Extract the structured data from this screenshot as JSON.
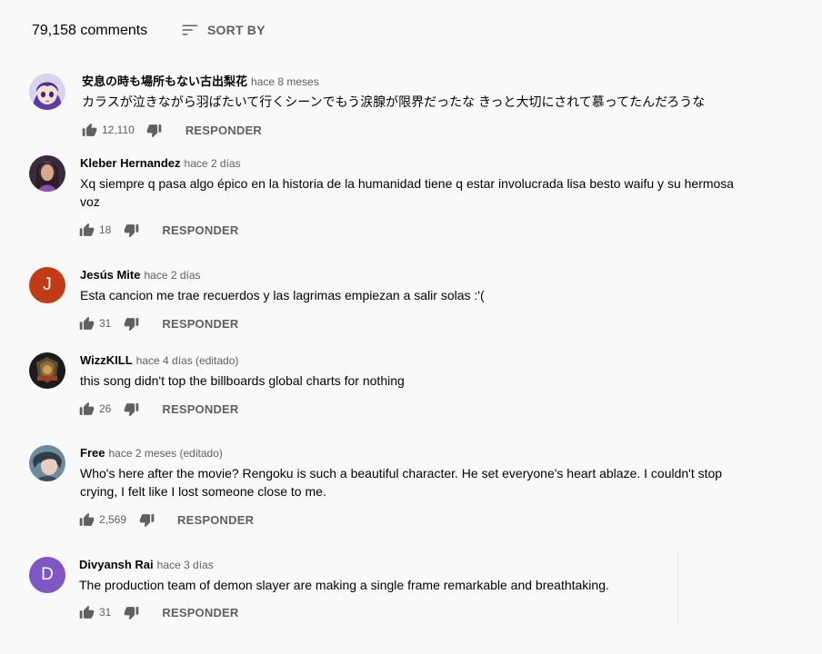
{
  "header": {
    "comment_count": "79,158 comments",
    "sort_label": "SORT BY"
  },
  "comments": [
    {
      "author": "安息の時も場所もない古出梨花",
      "time": "hace 8 meses",
      "lines": [
        "カラスが泣きながら羽ばたいて行くシーンでもう涙腺が限界だったな きっと大切にされて慕ってたんだろうな"
      ],
      "likes": "12,110",
      "reply": "RESPONDER"
    },
    {
      "author": "Kleber Hernandez",
      "time": "hace 2 días",
      "lines": [
        "Xq siempre q pasa algo épico en la historia de la humanidad tiene q estar involucrada lisa besto waifu y su hermosa",
        "voz"
      ],
      "likes": "18",
      "reply": "RESPONDER"
    },
    {
      "author": "Jesús Mite",
      "time": "hace 2 días",
      "avatar_letter": "J",
      "lines": [
        "Esta cancion me trae recuerdos y las lagrimas empiezan a salir solas :'("
      ],
      "likes": "31",
      "reply": "RESPONDER"
    },
    {
      "author": "WizzKILL",
      "time": "hace 4 días (editado)",
      "lines": [
        "this song didn't top the billboards global charts for nothing"
      ],
      "likes": "26",
      "reply": "RESPONDER"
    },
    {
      "author": "Free",
      "time": "hace 2 meses (editado)",
      "lines": [
        "Who's here after the movie? Rengoku is such a beautiful character. He set everyone's heart ablaze. I couldn't stop",
        "crying, I felt like I lost someone close to me."
      ],
      "likes": "2,569",
      "reply": "RESPONDER"
    },
    {
      "author": "Divyansh Rai",
      "time": "hace 3 días",
      "avatar_letter": "D",
      "lines": [
        "The production team of demon slayer are making a single frame remarkable and breathtaking."
      ],
      "likes": "31",
      "reply": "RESPONDER"
    }
  ],
  "colors": {
    "avatar_j": "#c23a16",
    "avatar_d": "#7e57c2",
    "icon": "#606060",
    "text_secondary": "#606060"
  },
  "icons": [
    "sort-icon",
    "thumbs-up-icon",
    "thumbs-down-icon"
  ]
}
